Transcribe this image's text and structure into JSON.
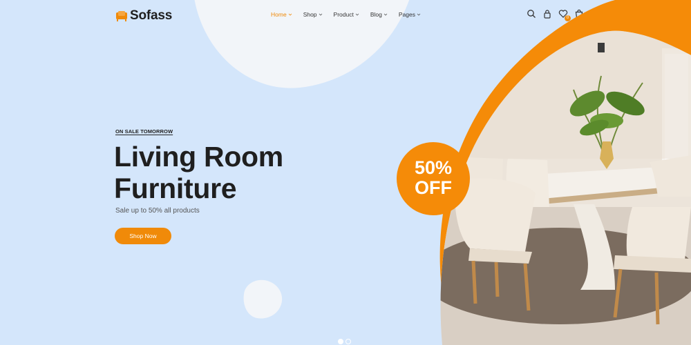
{
  "brand": {
    "name": "Sofass",
    "accent": "#f08a09",
    "background": "#d4e6fb"
  },
  "nav": {
    "items": [
      {
        "label": "Home",
        "active": true
      },
      {
        "label": "Shop",
        "active": false
      },
      {
        "label": "Product",
        "active": false
      },
      {
        "label": "Blog",
        "active": false
      },
      {
        "label": "Pages",
        "active": false
      }
    ]
  },
  "header_icons": [
    {
      "icon": "search-icon"
    },
    {
      "icon": "lock-icon"
    },
    {
      "icon": "heart-icon",
      "badge": "0"
    },
    {
      "icon": "cart-icon",
      "badge": "0"
    }
  ],
  "hero": {
    "kicker": "ON SALE TOMORROW",
    "title_line1": "Living Room",
    "title_line2": "Furniture",
    "subtitle": "Sale up to 50% all products",
    "cta": "Shop Now"
  },
  "promo_badge": {
    "percent": "50%",
    "label": "OFF"
  },
  "slider": {
    "count": 2,
    "active": 1
  }
}
